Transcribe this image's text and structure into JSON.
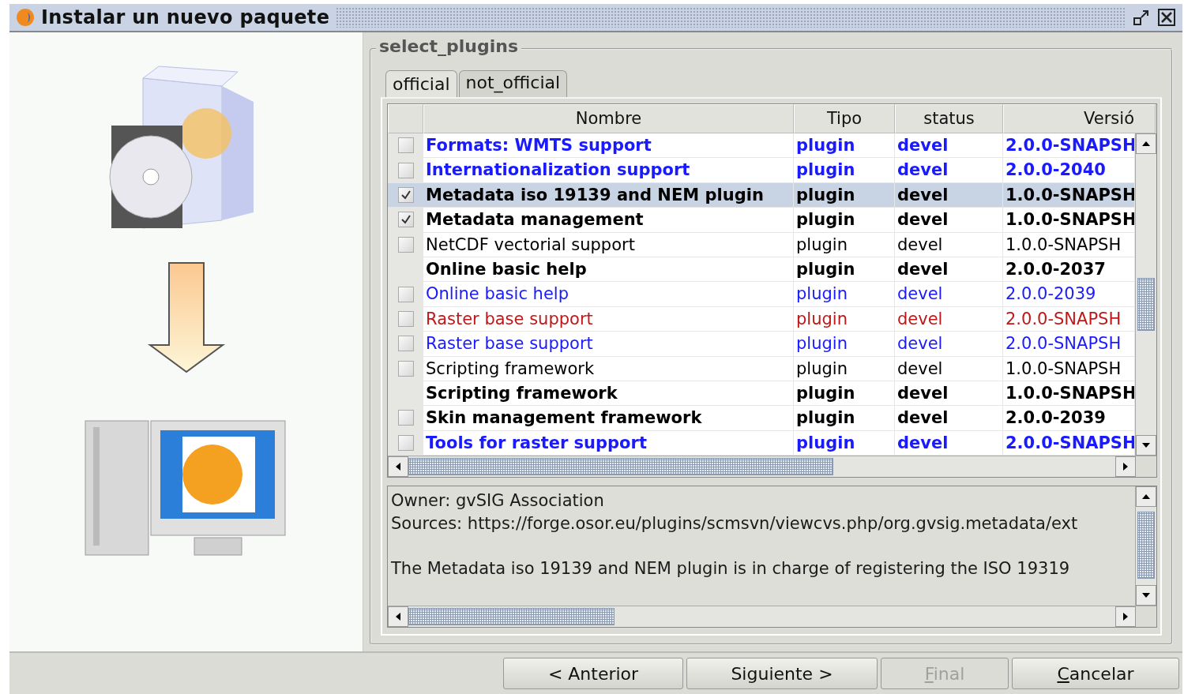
{
  "window": {
    "title": "Instalar un nuevo paquete"
  },
  "group": {
    "title": "select_plugins"
  },
  "tabs": [
    {
      "label": "official",
      "selected": true
    },
    {
      "label": "not_official",
      "selected": false
    }
  ],
  "table": {
    "columns": [
      "Nombre",
      "Tipo",
      "status",
      "Versió"
    ],
    "rows": [
      {
        "kind": "checkbox",
        "checked": false,
        "selected": false,
        "bold": true,
        "color": "#1a1aff",
        "cells": [
          "Formats: WMTS support",
          "plugin",
          "devel",
          "2.0.0-SNAPSH"
        ]
      },
      {
        "kind": "checkbox",
        "checked": false,
        "selected": false,
        "bold": true,
        "color": "#1a1aff",
        "cells": [
          "Internationalization support",
          "plugin",
          "devel",
          "2.0.0-2040"
        ]
      },
      {
        "kind": "checkbox",
        "checked": true,
        "selected": true,
        "bold": true,
        "color": "#000000",
        "cells": [
          "Metadata iso 19139 and NEM plugin",
          "plugin",
          "devel",
          "1.0.0-SNAPSH"
        ]
      },
      {
        "kind": "checkbox",
        "checked": true,
        "selected": false,
        "bold": true,
        "color": "#000000",
        "cells": [
          "Metadata management",
          "plugin",
          "devel",
          "1.0.0-SNAPSH"
        ]
      },
      {
        "kind": "checkbox",
        "checked": false,
        "selected": false,
        "bold": false,
        "color": "#000000",
        "cells": [
          "NetCDF vectorial support",
          "plugin",
          "devel",
          "1.0.0-SNAPSH"
        ]
      },
      {
        "kind": "plain",
        "selected": false,
        "bold": true,
        "color": "#000000",
        "cells": [
          "Online basic help",
          "plugin",
          "devel",
          "2.0.0-2037"
        ]
      },
      {
        "kind": "checkbox",
        "checked": false,
        "selected": false,
        "bold": false,
        "color": "#1a1aff",
        "cells": [
          "Online basic help",
          "plugin",
          "devel",
          "2.0.0-2039"
        ]
      },
      {
        "kind": "checkbox",
        "checked": false,
        "selected": false,
        "bold": false,
        "color": "#c01818",
        "cells": [
          "Raster base support",
          "plugin",
          "devel",
          "2.0.0-SNAPSH"
        ]
      },
      {
        "kind": "checkbox",
        "checked": false,
        "selected": false,
        "bold": false,
        "color": "#1a1aff",
        "cells": [
          "Raster base support",
          "plugin",
          "devel",
          "2.0.0-SNAPSH"
        ]
      },
      {
        "kind": "checkbox",
        "checked": false,
        "selected": false,
        "bold": false,
        "color": "#000000",
        "cells": [
          "Scripting framework",
          "plugin",
          "devel",
          "1.0.0-SNAPSH"
        ]
      },
      {
        "kind": "plain",
        "selected": false,
        "bold": true,
        "color": "#000000",
        "cells": [
          "Scripting framework",
          "plugin",
          "devel",
          "1.0.0-SNAPSH"
        ]
      },
      {
        "kind": "checkbox",
        "checked": false,
        "selected": false,
        "bold": true,
        "color": "#000000",
        "cells": [
          "Skin management framework",
          "plugin",
          "devel",
          "2.0.0-2039"
        ]
      },
      {
        "kind": "checkbox",
        "checked": false,
        "selected": false,
        "bold": true,
        "color": "#1a1aff",
        "cells": [
          "Tools for raster support",
          "plugin",
          "devel",
          "2.0.0-SNAPSH"
        ]
      }
    ]
  },
  "description": {
    "paragraphs": [
      [
        "Owner: gvSIG Association",
        "Sources: https://forge.osor.eu/plugins/scmsvn/viewcvs.php/org.gvsig.metadata/ext"
      ],
      [
        "The Metadata iso 19139 and NEM plugin is in charge of registering the ISO 19319"
      ]
    ]
  },
  "buttons": [
    {
      "label": "< Anterior",
      "disabled": false,
      "mnemonic": false
    },
    {
      "label": "Siguiente >",
      "disabled": false,
      "mnemonic": false
    },
    {
      "label": "Final",
      "disabled": true,
      "mnemonic": true
    },
    {
      "label": "Cancelar",
      "disabled": false,
      "mnemonic": true
    }
  ]
}
